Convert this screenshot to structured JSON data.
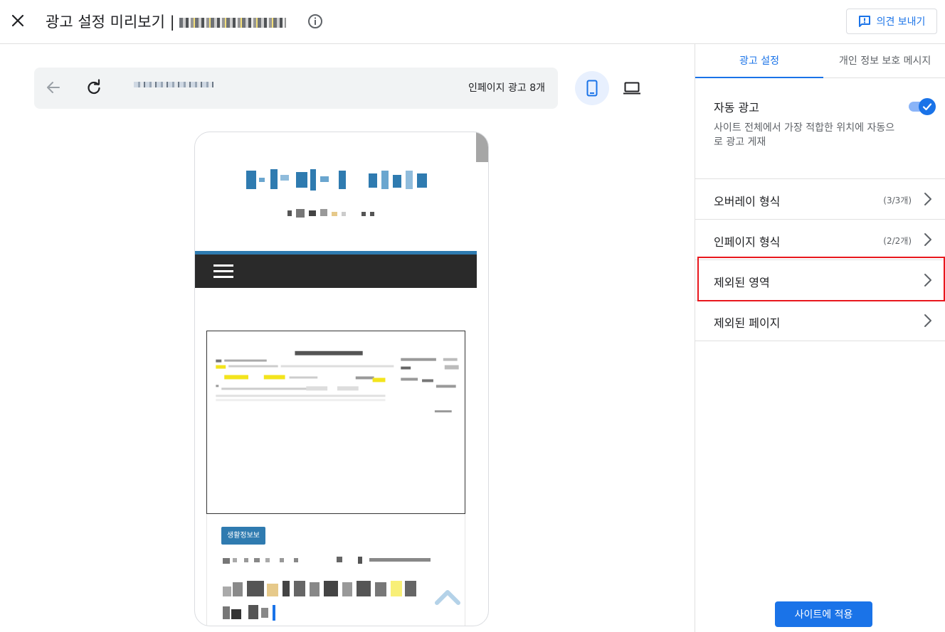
{
  "header": {
    "title": "광고 설정 미리보기 |",
    "feedback_label": "의견 보내기"
  },
  "preview": {
    "ad_count_label": "인페이지 광고 8개",
    "article": {
      "category": "생활정보보"
    }
  },
  "sidebar": {
    "tabs": [
      {
        "label": "광고 설정",
        "active": true
      },
      {
        "label": "개인 정보 보호 메시지",
        "active": false
      }
    ],
    "auto_ads": {
      "title": "자동 광고",
      "description": "사이트 전체에서 가장 적합한 위치에 자동으로 광고 게재",
      "enabled": true
    },
    "rows": [
      {
        "label": "오버레이 형식",
        "count": "(3/3개)"
      },
      {
        "label": "인페이지 형식",
        "count": "(2/2개)"
      },
      {
        "label": "제외된 영역",
        "count": ""
      },
      {
        "label": "제외된 페이지",
        "count": ""
      }
    ],
    "apply_label": "사이트에 적용"
  },
  "colors": {
    "accent": "#1a73e8",
    "highlight": "#e8171d",
    "nav_bar": "#2a2a2a",
    "site_blue": "#2f7bb0"
  }
}
